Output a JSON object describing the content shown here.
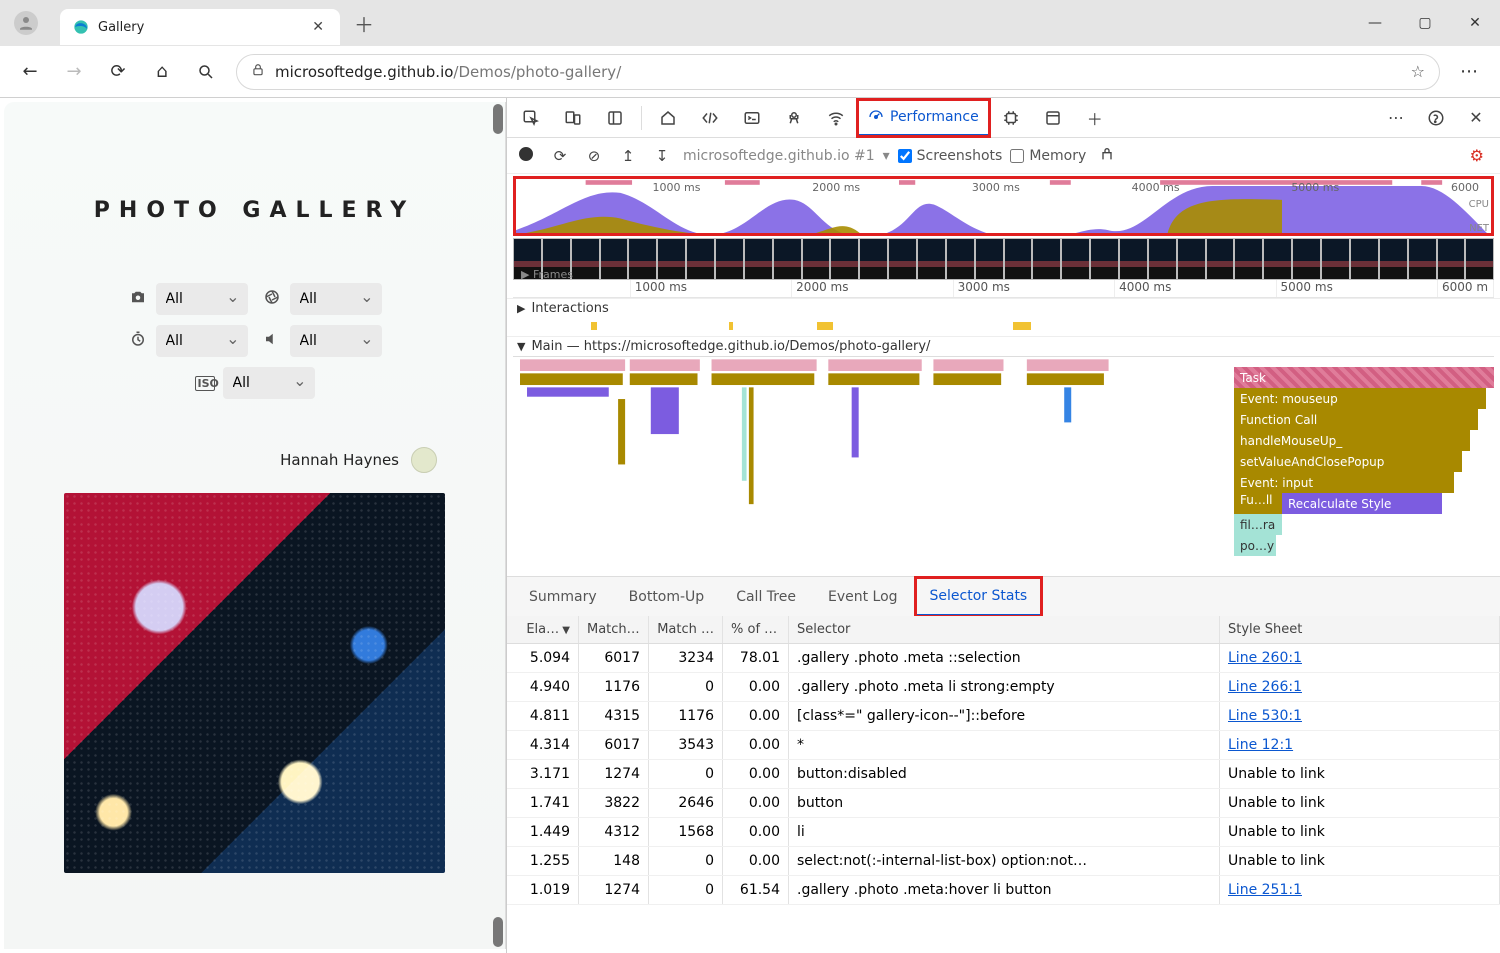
{
  "browser": {
    "tab_title": "Gallery",
    "url_host": "microsoftedge.github.io",
    "url_path": "/Demos/photo-gallery/"
  },
  "page": {
    "title": "PHOTO GALLERY",
    "filters": {
      "camera": "All",
      "aperture": "All",
      "exposure": "All",
      "sound": "All",
      "iso_label": "ISO",
      "iso": "All"
    },
    "credit": "Hannah Haynes"
  },
  "devtools": {
    "active_panel": "Performance",
    "record_target": "microsoftedge.github.io #1",
    "check_screenshots_label": "Screenshots",
    "check_memory_label": "Memory",
    "overview_ticks": [
      "1000 ms",
      "2000 ms",
      "3000 ms",
      "4000 ms",
      "5000 ms",
      "6000"
    ],
    "overview_cpu": "CPU",
    "overview_net": "NET",
    "ruler_ticks": [
      "1000 ms",
      "2000 ms",
      "3000 ms",
      "4000 ms",
      "5000 ms",
      "6000 m"
    ],
    "frames_label": "Frames",
    "interactions_label": "Interactions",
    "main_label": "Main — https://microsoftedge.github.io/Demos/photo-gallery/",
    "flame_stack": {
      "task": "Task",
      "event_mouseup": "Event: mouseup",
      "function_call": "Function Call",
      "handle": "handleMouseUp_",
      "setvalue": "setValueAndClosePopup",
      "event_input": "Event: input",
      "fu": "Fu…ll",
      "recalc": "Recalculate Style",
      "fil": "fil…ra",
      "po": "po…y"
    },
    "detail_tabs": [
      "Summary",
      "Bottom-Up",
      "Call Tree",
      "Event Log",
      "Selector Stats"
    ],
    "active_detail_tab": "Selector Stats",
    "table": {
      "headers": {
        "elapsed": "Ela…",
        "match": "Match …",
        "attempts": "Match …",
        "pct": "% of sl…",
        "selector": "Selector",
        "sheet": "Style Sheet"
      },
      "rows": [
        {
          "elapsed": "5.094",
          "match": "6017",
          "attempts": "3234",
          "pct": "78.01",
          "selector": ".gallery .photo .meta ::selection",
          "sheet": "Line 260:1",
          "link": true
        },
        {
          "elapsed": "4.940",
          "match": "1176",
          "attempts": "0",
          "pct": "0.00",
          "selector": ".gallery .photo .meta li strong:empty",
          "sheet": "Line 266:1",
          "link": true
        },
        {
          "elapsed": "4.811",
          "match": "4315",
          "attempts": "1176",
          "pct": "0.00",
          "selector": "[class*=\" gallery-icon--\"]::before",
          "sheet": "Line 530:1",
          "link": true
        },
        {
          "elapsed": "4.314",
          "match": "6017",
          "attempts": "3543",
          "pct": "0.00",
          "selector": "*",
          "sheet": "Line 12:1",
          "link": true
        },
        {
          "elapsed": "3.171",
          "match": "1274",
          "attempts": "0",
          "pct": "0.00",
          "selector": "button:disabled",
          "sheet": "Unable to link",
          "link": false
        },
        {
          "elapsed": "1.741",
          "match": "3822",
          "attempts": "2646",
          "pct": "0.00",
          "selector": "button",
          "sheet": "Unable to link",
          "link": false
        },
        {
          "elapsed": "1.449",
          "match": "4312",
          "attempts": "1568",
          "pct": "0.00",
          "selector": "li",
          "sheet": "Unable to link",
          "link": false
        },
        {
          "elapsed": "1.255",
          "match": "148",
          "attempts": "0",
          "pct": "0.00",
          "selector": "select:not(:-internal-list-box) option:not…",
          "sheet": "Unable to link",
          "link": false
        },
        {
          "elapsed": "1.019",
          "match": "1274",
          "attempts": "0",
          "pct": "61.54",
          "selector": ".gallery .photo .meta:hover li button",
          "sheet": "Line 251:1",
          "link": true
        }
      ]
    }
  }
}
